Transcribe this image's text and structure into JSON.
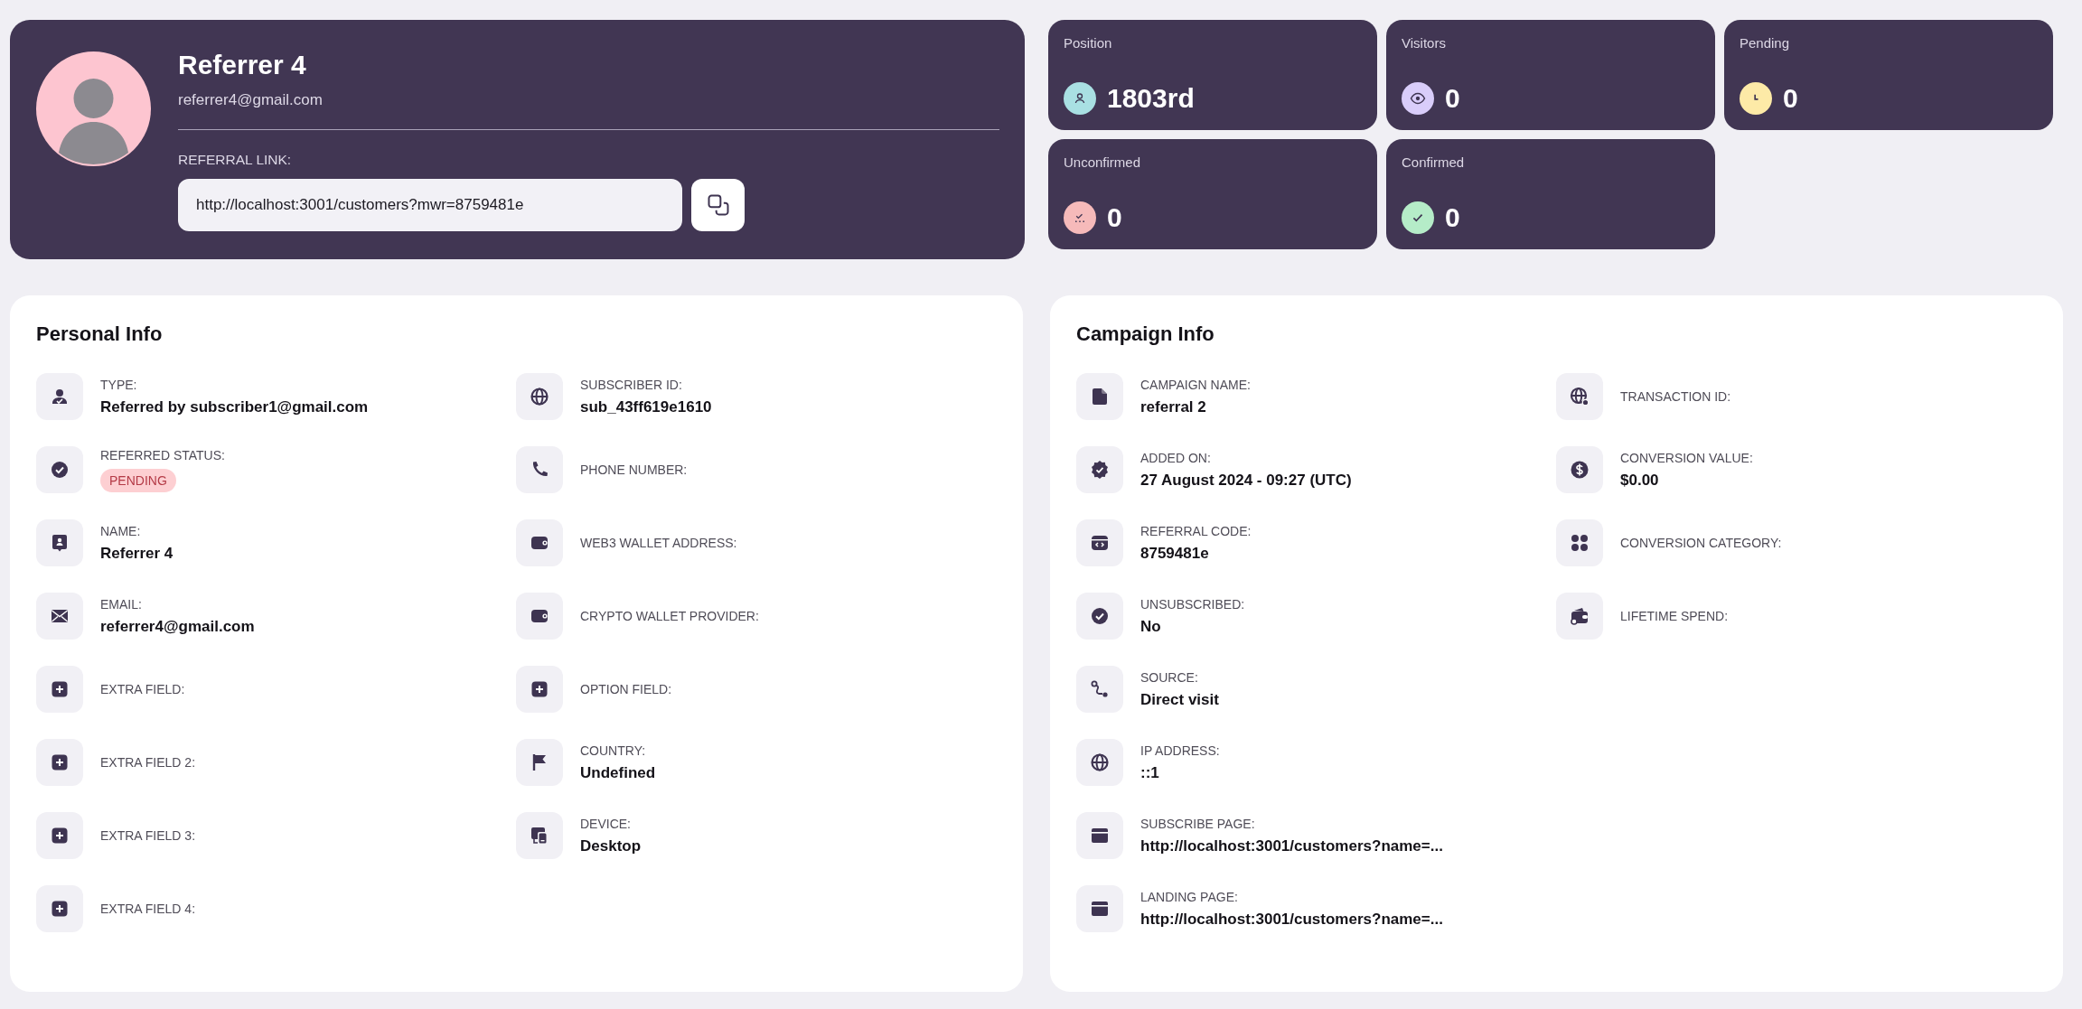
{
  "profile": {
    "name": "Referrer 4",
    "email": "referrer4@gmail.com",
    "link_label": "REFERRAL LINK:",
    "link": "http://localhost:3001/customers?mwr=8759481e"
  },
  "stats": [
    {
      "label": "Position",
      "value": "1803rd",
      "color": "#a9e0e3"
    },
    {
      "label": "Visitors",
      "value": "0",
      "color": "#d9cdfa"
    },
    {
      "label": "Pending",
      "value": "0",
      "color": "#fdeaa7"
    },
    {
      "label": "Unconfirmed",
      "value": "0",
      "color": "#f6baba"
    },
    {
      "label": "Confirmed",
      "value": "0",
      "color": "#b5ecc8"
    }
  ],
  "personal_info": {
    "title": "Personal Info",
    "columns": [
      [
        {
          "kind": "text",
          "label": "TYPE:",
          "value": "Referred by subscriber1@gmail.com"
        },
        {
          "kind": "badge",
          "label": "REFERRED STATUS:",
          "value": "PENDING"
        },
        {
          "kind": "text",
          "label": "NAME:",
          "value": "Referrer 4"
        },
        {
          "kind": "text",
          "label": "EMAIL:",
          "value": "referrer4@gmail.com"
        },
        {
          "label": "EXTRA FIELD:"
        },
        {
          "label": "EXTRA FIELD 2:"
        },
        {
          "label": "EXTRA FIELD 3:"
        },
        {
          "label": "EXTRA FIELD 4:"
        }
      ],
      [
        {
          "kind": "text",
          "label": "SUBSCRIBER ID:",
          "value": "sub_43ff619e1610"
        },
        {
          "label": "PHONE NUMBER:"
        },
        {
          "label": "WEB3 WALLET ADDRESS:"
        },
        {
          "label": "CRYPTO WALLET PROVIDER:"
        },
        {
          "label": "OPTION FIELD:"
        },
        {
          "kind": "text",
          "label": "COUNTRY:",
          "value": "Undefined"
        },
        {
          "kind": "text",
          "label": "DEVICE:",
          "value": "Desktop"
        }
      ]
    ]
  },
  "campaign_info": {
    "title": "Campaign Info",
    "columns": [
      [
        {
          "kind": "text",
          "label": "CAMPAIGN NAME:",
          "value": "referral 2"
        },
        {
          "kind": "text",
          "label": "ADDED ON:",
          "value": "27 August 2024 - 09:27 (UTC)"
        },
        {
          "kind": "text",
          "label": "REFERRAL CODE:",
          "value": "8759481e"
        },
        {
          "kind": "text",
          "label": "UNSUBSCRIBED:",
          "value": "No"
        },
        {
          "kind": "text",
          "label": "SOURCE:",
          "value": "Direct visit"
        },
        {
          "kind": "text",
          "label": "IP ADDRESS:",
          "value": "::1"
        },
        {
          "kind": "text",
          "label": "SUBSCRIBE PAGE:",
          "value": "http://localhost:3001/customers?name=..."
        },
        {
          "kind": "text",
          "label": "LANDING PAGE:",
          "value": "http://localhost:3001/customers?name=..."
        }
      ],
      [
        {
          "label": "TRANSACTION ID:"
        },
        {
          "kind": "text",
          "label": "CONVERSION VALUE:",
          "value": "$0.00"
        },
        {
          "label": "CONVERSION CATEGORY:"
        },
        {
          "label": "LIFETIME SPEND:"
        }
      ]
    ]
  }
}
